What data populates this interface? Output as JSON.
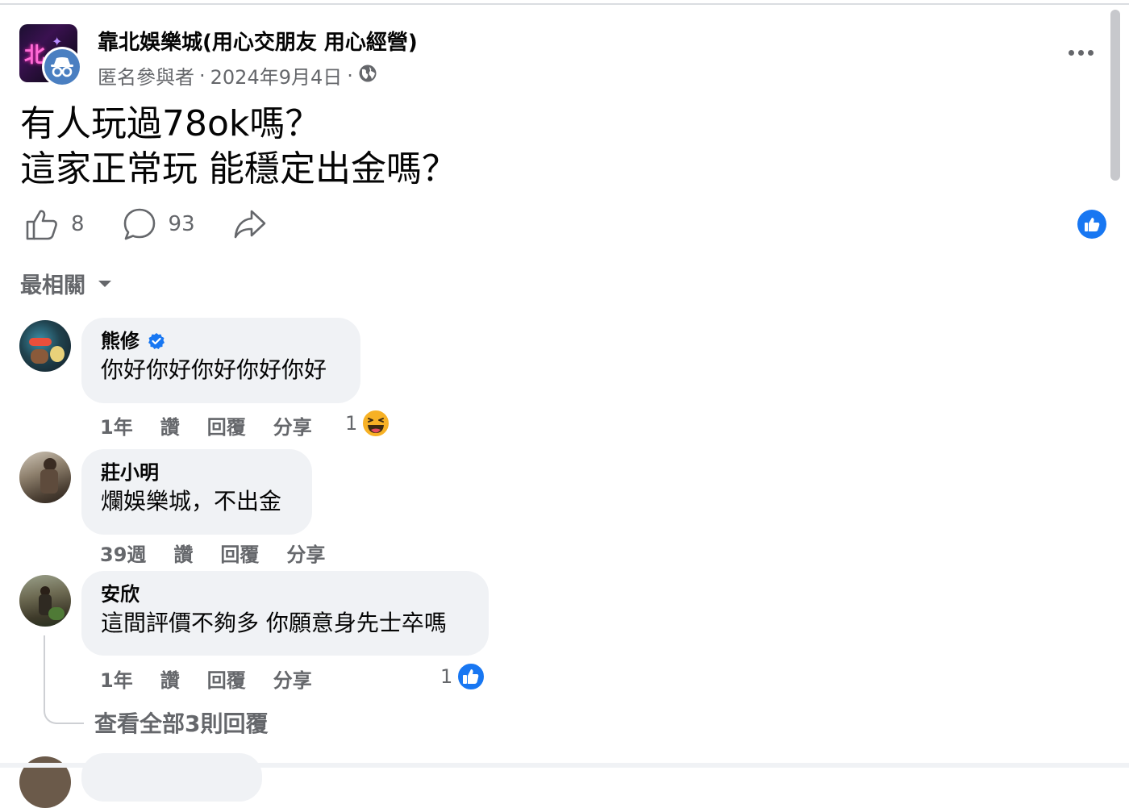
{
  "post": {
    "group_name": "靠北娛樂城(用心交朋友 用心經營)",
    "author": "匿名參與者",
    "separator": "·",
    "date": "2024年9月4日",
    "body_line1": "有人玩過78ok嗎？",
    "body_line2": "這家正常玩 能穩定出金嗎？",
    "like_count": "8",
    "comment_count": "93"
  },
  "sort_label": "最相關",
  "comments": [
    {
      "name": "熊修",
      "verified": true,
      "text": "你好你好你好你好你好",
      "time": "1年",
      "like": "讚",
      "reply": "回覆",
      "share": "分享",
      "reaction_count": "1",
      "reaction": "haha"
    },
    {
      "name": "莊小明",
      "text": "爛娛樂城，不出金",
      "time": "39週",
      "like": "讚",
      "reply": "回覆",
      "share": "分享"
    },
    {
      "name": "安欣",
      "text": "這間評價不夠多 你願意身先士卒嗎",
      "time": "1年",
      "like": "讚",
      "reply": "回覆",
      "share": "分享",
      "reaction_count": "1",
      "reaction": "like"
    }
  ],
  "view_replies": "查看全部3則回覆",
  "colors": {
    "accent_blue": "#1877f2",
    "secondary_text": "#65676b",
    "bubble_bg": "#f0f2f5"
  },
  "icons": [
    "anonymous-icon",
    "globe-icon",
    "more-icon",
    "like-icon",
    "comment-icon",
    "share-icon",
    "like-reaction-icon",
    "haha-reaction-icon",
    "verified-icon",
    "caret-down-icon"
  ]
}
